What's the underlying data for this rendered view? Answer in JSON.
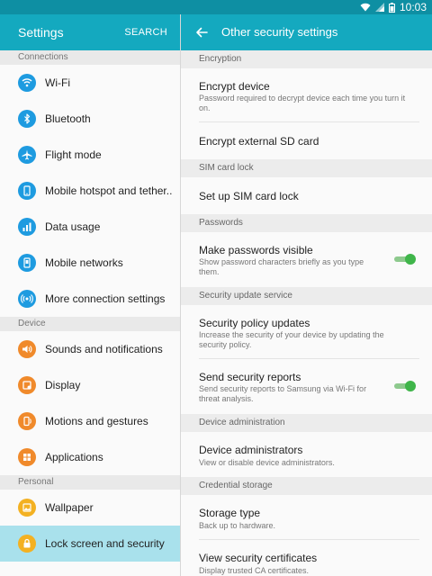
{
  "status_bar": {
    "time": "10:03"
  },
  "left_header": {
    "title": "Settings",
    "search_label": "SEARCH"
  },
  "right_header": {
    "title": "Other security settings"
  },
  "colors": {
    "accent": "#14a9bf",
    "statusbar": "#0e8fa3",
    "toggle_on": "#3fb54a",
    "selected_bg": "#a9e1ec"
  },
  "left_sections": [
    {
      "title": "Connections",
      "items": [
        {
          "label": "Wi-Fi",
          "icon": "wifi-icon",
          "color": "#1e9be0"
        },
        {
          "label": "Bluetooth",
          "icon": "bluetooth-icon",
          "color": "#1e9be0"
        },
        {
          "label": "Flight mode",
          "icon": "airplane-icon",
          "color": "#1e9be0"
        },
        {
          "label": "Mobile hotspot and tether..",
          "icon": "hotspot-icon",
          "color": "#1e9be0"
        },
        {
          "label": "Data usage",
          "icon": "data-usage-icon",
          "color": "#1e9be0"
        },
        {
          "label": "Mobile networks",
          "icon": "mobile-networks-icon",
          "color": "#1e9be0"
        },
        {
          "label": "More connection settings",
          "icon": "more-connections-icon",
          "color": "#1e9be0"
        }
      ]
    },
    {
      "title": "Device",
      "items": [
        {
          "label": "Sounds and notifications",
          "icon": "volume-icon",
          "color": "#f08a2b"
        },
        {
          "label": "Display",
          "icon": "display-icon",
          "color": "#f08a2b"
        },
        {
          "label": "Motions and gestures",
          "icon": "motion-icon",
          "color": "#f08a2b"
        },
        {
          "label": "Applications",
          "icon": "apps-grid-icon",
          "color": "#f08a2b"
        }
      ]
    },
    {
      "title": "Personal",
      "items": [
        {
          "label": "Wallpaper",
          "icon": "wallpaper-icon",
          "color": "#f3b122"
        },
        {
          "label": "Lock screen and security",
          "icon": "lock-icon",
          "color": "#f3b122",
          "selected": true
        }
      ]
    }
  ],
  "right_sections": [
    {
      "title": "Encryption"
    },
    {
      "title": "SIM card lock"
    },
    {
      "title": "Passwords"
    },
    {
      "title": "Security update service"
    },
    {
      "title": "Device administration"
    },
    {
      "title": "Credential storage"
    }
  ],
  "right_items": {
    "encrypt_device": {
      "title": "Encrypt device",
      "sub": "Password required to decrypt device each time you turn it on."
    },
    "encrypt_sd": {
      "title": "Encrypt external SD card"
    },
    "sim_lock": {
      "title": "Set up SIM card lock"
    },
    "passwords_visible": {
      "title": "Make passwords visible",
      "sub": "Show password characters briefly as you type them.",
      "toggle_on": true
    },
    "policy_updates": {
      "title": "Security policy updates",
      "sub": "Increase the security of your device by updating the security policy."
    },
    "send_reports": {
      "title": "Send security reports",
      "sub": "Send security reports to Samsung via Wi-Fi for threat analysis.",
      "toggle_on": true
    },
    "device_admins": {
      "title": "Device administrators",
      "sub": "View or disable device administrators."
    },
    "storage_type": {
      "title": "Storage type",
      "sub": "Back up to hardware."
    },
    "view_certs": {
      "title": "View security certificates",
      "sub": "Display trusted CA certificates."
    }
  }
}
